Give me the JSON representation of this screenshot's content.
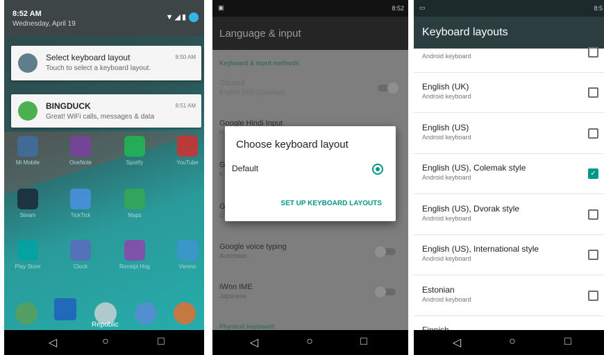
{
  "panel1": {
    "status_time": "8:52 AM",
    "status_date": "Wednesday, April 19",
    "notifications": [
      {
        "title": "Select keyboard layout",
        "text": "Touch to select a keyboard layout.",
        "time": "8:50 AM",
        "icon": "keyboard-icon",
        "color": "#607d8b"
      },
      {
        "title": "BINGDUCK",
        "text": "Great! WiFi calls, messages & data",
        "time": "8:51 AM",
        "icon": "wifi-icon",
        "color": "#4caf50"
      }
    ],
    "apps": [
      {
        "label": "Mi Mobile",
        "color": "#3f6fa0"
      },
      {
        "label": "OneNote",
        "color": "#7b3fa0"
      },
      {
        "label": "Spotify",
        "color": "#1db954"
      },
      {
        "label": "YouTube",
        "color": "#d32f2f"
      },
      {
        "label": "Steam",
        "color": "#1b2838"
      },
      {
        "label": "TickTick",
        "color": "#4a90e2"
      },
      {
        "label": "Maps",
        "color": "#34a853"
      },
      {
        "label": "Play Store",
        "color": "#00a3a3"
      },
      {
        "label": "Clock",
        "color": "#5c6bc0"
      },
      {
        "label": "Receipt Hog",
        "color": "#8e44ad"
      },
      {
        "label": "Venmo",
        "color": "#3d95ce"
      }
    ],
    "dock_label": "Republic"
  },
  "panel2": {
    "status_time": "8:52",
    "title": "Language & input",
    "section_keyboard": "Keyboard & input methods",
    "items": [
      {
        "name": "Gboard",
        "sub": "English (US) (Colemak)"
      },
      {
        "name": "Google Hindi Input",
        "sub": "H"
      },
      {
        "name": "G",
        "sub": "K"
      },
      {
        "name": "G",
        "sub": "C"
      },
      {
        "name": "Google voice typing",
        "sub": "Automatic"
      },
      {
        "name": "iWnn IME",
        "sub": "Japanese"
      }
    ],
    "section_physical": "Physical keyboard",
    "dialog": {
      "title": "Choose keyboard layout",
      "option": "Default",
      "button": "SET UP KEYBOARD LAYOUTS"
    }
  },
  "panel3": {
    "status_time": "8:5",
    "title": "Keyboard layouts",
    "layouts": [
      {
        "name": "",
        "sub": "Android keyboard",
        "checked": false
      },
      {
        "name": "English (UK)",
        "sub": "Android keyboard",
        "checked": false
      },
      {
        "name": "English (US)",
        "sub": "Android keyboard",
        "checked": false
      },
      {
        "name": "English (US), Colemak style",
        "sub": "Android keyboard",
        "checked": true
      },
      {
        "name": "English (US), Dvorak style",
        "sub": "Android keyboard",
        "checked": false
      },
      {
        "name": "English (US), International style",
        "sub": "Android keyboard",
        "checked": false
      },
      {
        "name": "Estonian",
        "sub": "Android keyboard",
        "checked": false
      },
      {
        "name": "Finnish",
        "sub": "",
        "checked": false
      }
    ]
  },
  "nav": {
    "back": "◁",
    "home": "○",
    "recents": "□"
  },
  "colors": {
    "accent": "#009688",
    "toolbar": "#2c3d3f"
  }
}
